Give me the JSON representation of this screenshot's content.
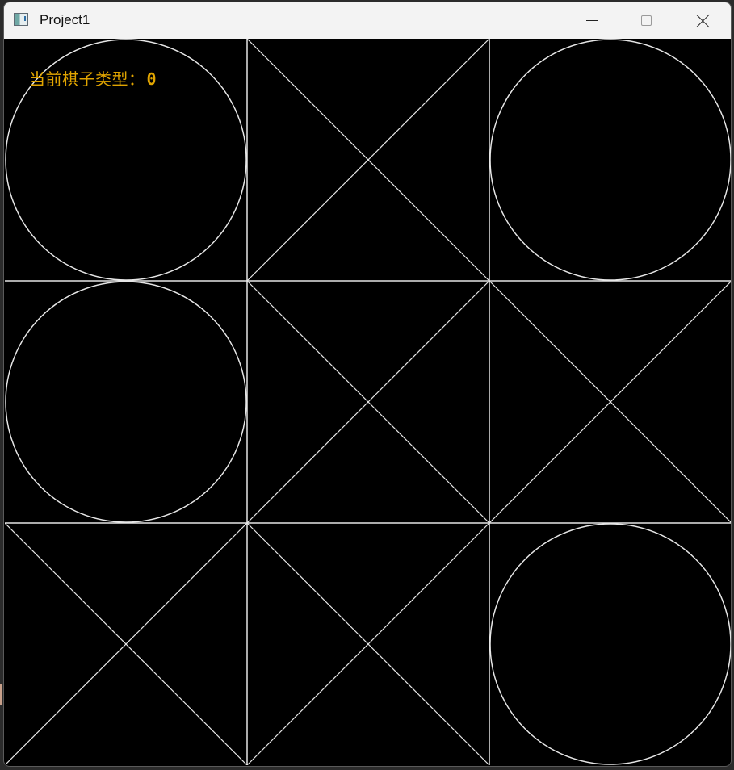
{
  "window": {
    "title": "Project1",
    "icon": "app-window-icon",
    "controls": {
      "minimize_icon": "minimize-icon",
      "maximize_icon": "maximize-icon",
      "close_icon": "close-icon"
    }
  },
  "game": {
    "status_label": "当前棋子类型：",
    "status_value": "0",
    "status_color": "#e0a400",
    "line_color": "#e6e6e6",
    "background": "#000000",
    "grid_size": 3,
    "board": [
      [
        "O",
        "X",
        "O"
      ],
      [
        "O",
        "X",
        "X"
      ],
      [
        "X",
        "X",
        "O"
      ]
    ]
  }
}
